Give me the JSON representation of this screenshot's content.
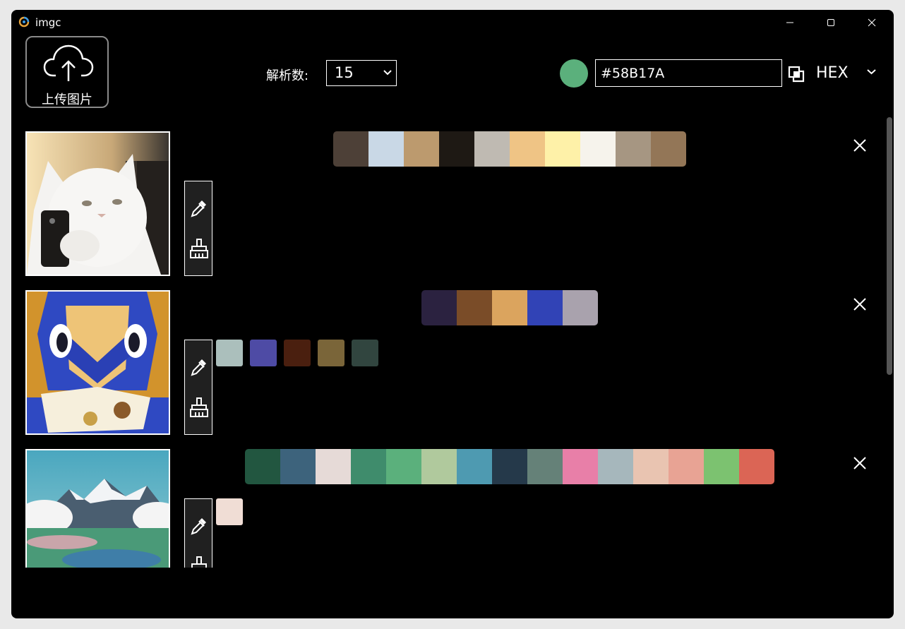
{
  "window": {
    "title": "imgc"
  },
  "toolbar": {
    "upload_label": "上传图片",
    "count_label": "解析数:",
    "count_value": "15",
    "color_value": "#58B17A",
    "color_preview": "#5BB07C",
    "format": "HEX"
  },
  "rows": [
    {
      "image": "white-cat",
      "palette": [
        "#4D4037",
        "#C9D8E6",
        "#BC9A6E",
        "#1E1914",
        "#BFBAB2",
        "#EFC485",
        "#FEF1A8",
        "#F6F3EC",
        "#A69682",
        "#937657"
      ],
      "picked": []
    },
    {
      "image": "blue-toy-figure",
      "palette": [
        "#2B2240",
        "#7A4C28",
        "#DBA45E",
        "#3143B6",
        "#A9A2AD"
      ],
      "picked": [
        "#ABBFBC",
        "#4E4BA5",
        "#4A1F0F",
        "#7A6539",
        "#31453F"
      ]
    },
    {
      "image": "mountain-landscape",
      "palette": [
        "#225640",
        "#3D637C",
        "#E6DAD7",
        "#3F8C6C",
        "#5BB07C",
        "#B0C99D",
        "#4E9AB1",
        "#25394A",
        "#658178",
        "#E87FA8",
        "#A6B7BC",
        "#E9C4B1",
        "#E8A394",
        "#7CC270",
        "#DB6555"
      ],
      "picked": [
        "#F0DDD5"
      ]
    }
  ]
}
